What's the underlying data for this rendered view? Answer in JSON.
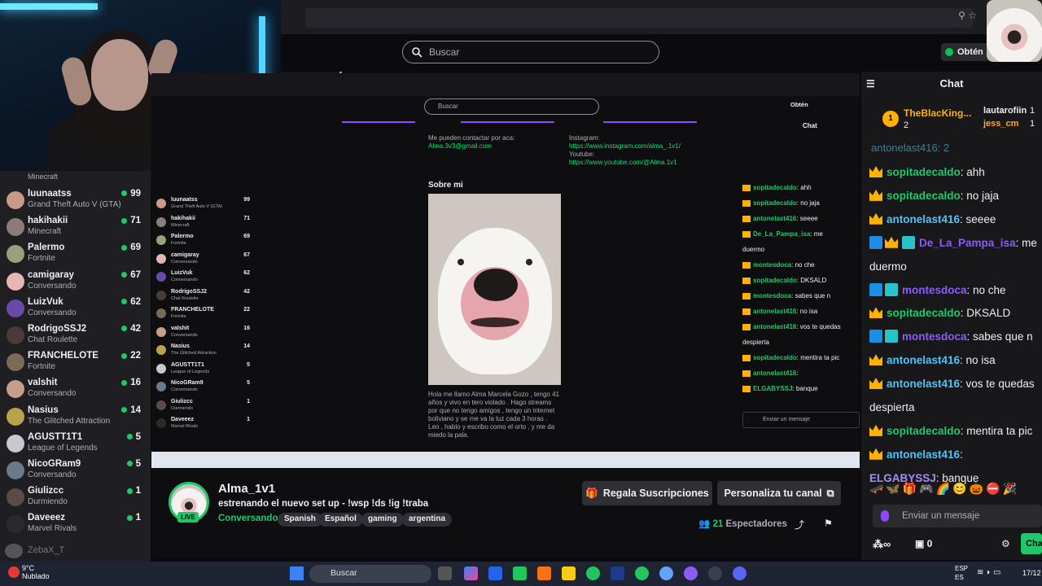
{
  "browser": {
    "search_placeholder": "Buscar",
    "obten_label": "Obtén"
  },
  "sidebar": {
    "top_partial": "Minecraft",
    "channels": [
      {
        "name": "luunaatss",
        "game": "Grand Theft Auto V (GTA)",
        "viewers": "99",
        "color": "#c89a8a"
      },
      {
        "name": "hakihakii",
        "game": "Minecraft",
        "viewers": "71",
        "color": "#8b7c7a"
      },
      {
        "name": "Palermo",
        "game": "Fortnite",
        "viewers": "69",
        "color": "#9aa07a"
      },
      {
        "name": "camigaray",
        "game": "Conversando",
        "viewers": "67",
        "color": "#e6b6b2"
      },
      {
        "name": "LuizVuk",
        "game": "Conversando",
        "viewers": "62",
        "color": "#6a4aa8"
      },
      {
        "name": "RodrigoSSJ2",
        "game": "Chat Roulette",
        "viewers": "42",
        "color": "#4a3a3a"
      },
      {
        "name": "FRANCHELOTE",
        "game": "Fortnite",
        "viewers": "22",
        "color": "#7a6a5a"
      },
      {
        "name": "valshit",
        "game": "Conversando",
        "viewers": "16",
        "color": "#c4a08a"
      },
      {
        "name": "Nasius",
        "game": "The Glitched Attraction",
        "viewers": "14",
        "color": "#b8a24a"
      },
      {
        "name": "AGUSTT1T1",
        "game": "League of Legends",
        "viewers": "5",
        "color": "#c8c8d0"
      },
      {
        "name": "NicoGRam9",
        "game": "Conversando",
        "viewers": "5",
        "color": "#6a7a8a"
      },
      {
        "name": "Giulizcc",
        "game": "Durmiendo",
        "viewers": "1",
        "color": "#5a4a4a"
      },
      {
        "name": "Daveeez",
        "game": "Marvel Rivals",
        "viewers": "1",
        "color": "#2a2a2a"
      }
    ],
    "bottom_partial": "ZebaX_T"
  },
  "inner": {
    "search_placeholder": "Buscar",
    "obten_label": "Obtén",
    "chat_title": "Chat",
    "contact_label": "Me pueden contactar por aca:",
    "contact_email": "Alma.3v3@gmail.com",
    "instagram_label": "Instagram:",
    "instagram_url": "https://www.instagram.com/alma_.1v1/",
    "youtube_label": "Youtube:",
    "youtube_url": "https://www.youtube.com/@Alma.1v1",
    "about_title": "Sobre mi",
    "bio": [
      "Hola me llamo Alma Marcela Gozo , tengo 41",
      "años y vivo en tero violado . Hago streams",
      "por que no tengo amigos , tengo un internet",
      "boliviano y se me va la luz cada 3 horas .",
      "Leo , hablo y escribo como el orto , y me da",
      "miedo la pala."
    ],
    "chat": [
      {
        "u": "sopitadecaldo",
        "t": ": ahh"
      },
      {
        "u": "sopitadecaldo",
        "t": ": no jaja"
      },
      {
        "u": "antonelast416",
        "t": ": seeee"
      },
      {
        "u": "De_La_Pampa_isa",
        "t": ": me"
      },
      {
        "u": "",
        "t": "duermo"
      },
      {
        "u": "montesdoca",
        "t": ": no che"
      },
      {
        "u": "sopitadecaldo",
        "t": ": DKSALD"
      },
      {
        "u": "montesdoca",
        "t": ": sabes que n"
      },
      {
        "u": "antonelast416",
        "t": ": no isa"
      },
      {
        "u": "antonelast416",
        "t": ": vos te quedas"
      },
      {
        "u": "",
        "t": "despierta"
      },
      {
        "u": "sopitadecaldo",
        "t": ": mentira ta pic"
      },
      {
        "u": "antonelast416",
        "t": ":"
      },
      {
        "u": "ELGABYSSJ",
        "t": ": banque"
      }
    ],
    "input_placeholder": "Enviar un mensaje"
  },
  "channel": {
    "name": "Alma_1v1",
    "title": "estrenando el nuevo set up  - !wsp !ds !ig !traba",
    "category": "Conversando",
    "live": "LIVE",
    "tags": [
      "Spanish",
      "Español",
      "gaming",
      "argentina"
    ],
    "gift_button": "Regala Suscripciones",
    "customize_button": "Personaliza tu canal",
    "viewers_count": "21",
    "viewers_label": "Espectadores"
  },
  "chat": {
    "title": "Chat",
    "gifters": [
      {
        "rank": "1",
        "name": "TheBlacKing...",
        "amount": "2"
      },
      {
        "name": "lautarofiin",
        "amount": "1"
      },
      {
        "name": "jess_cm",
        "amount": "1"
      }
    ],
    "partial_top": "antonelast416: 2",
    "messages": [
      {
        "badges": [
          "crown"
        ],
        "user": "sopitadecaldo",
        "color": "#1ec96b",
        "text": ": ahh"
      },
      {
        "badges": [
          "crown"
        ],
        "user": "sopitadecaldo",
        "color": "#1ec96b",
        "text": ": no jaja"
      },
      {
        "badges": [
          "crown"
        ],
        "user": "antonelast416",
        "color": "#4fc3f7",
        "text": ": seeee"
      },
      {
        "badges": [
          "b1",
          "crown",
          "b2"
        ],
        "user": "De_La_Pampa_isa",
        "color": "#8b5cf6",
        "text": ": me"
      },
      {
        "badges": [],
        "user": "",
        "color": "#efeff1",
        "text": "duermo"
      },
      {
        "badges": [
          "b1",
          "b2"
        ],
        "user": "montesdoca",
        "color": "#8b5cf6",
        "text": ": no che"
      },
      {
        "badges": [
          "crown"
        ],
        "user": "sopitadecaldo",
        "color": "#1ec96b",
        "text": ": DKSALD"
      },
      {
        "badges": [
          "b1",
          "b2"
        ],
        "user": "montesdoca",
        "color": "#8b5cf6",
        "text": ": sabes que n"
      },
      {
        "badges": [
          "crown"
        ],
        "user": "antonelast416",
        "color": "#4fc3f7",
        "text": ": no isa"
      },
      {
        "badges": [
          "crown"
        ],
        "user": "antonelast416",
        "color": "#4fc3f7",
        "text": ": vos te quedas"
      },
      {
        "badges": [],
        "user": "",
        "color": "#efeff1",
        "text": "despierta"
      },
      {
        "badges": [
          "crown"
        ],
        "user": "sopitadecaldo",
        "color": "#1ec96b",
        "text": ": mentira ta pic"
      },
      {
        "badges": [
          "crown"
        ],
        "user": "antonelast416",
        "color": "#4fc3f7",
        "text": ":"
      },
      {
        "badges": [],
        "user": "ELGABYSSJ",
        "color": "#a78bfa",
        "text": ": banque"
      }
    ],
    "input_placeholder": "Enviar un mensaje",
    "points": "0",
    "send_label": "Cha"
  },
  "taskbar": {
    "weather_temp": "9°C",
    "weather_desc": "Nublado",
    "search_placeholder": "Buscar",
    "lang": "ESP",
    "lang2": "ES",
    "time": "17/12"
  }
}
